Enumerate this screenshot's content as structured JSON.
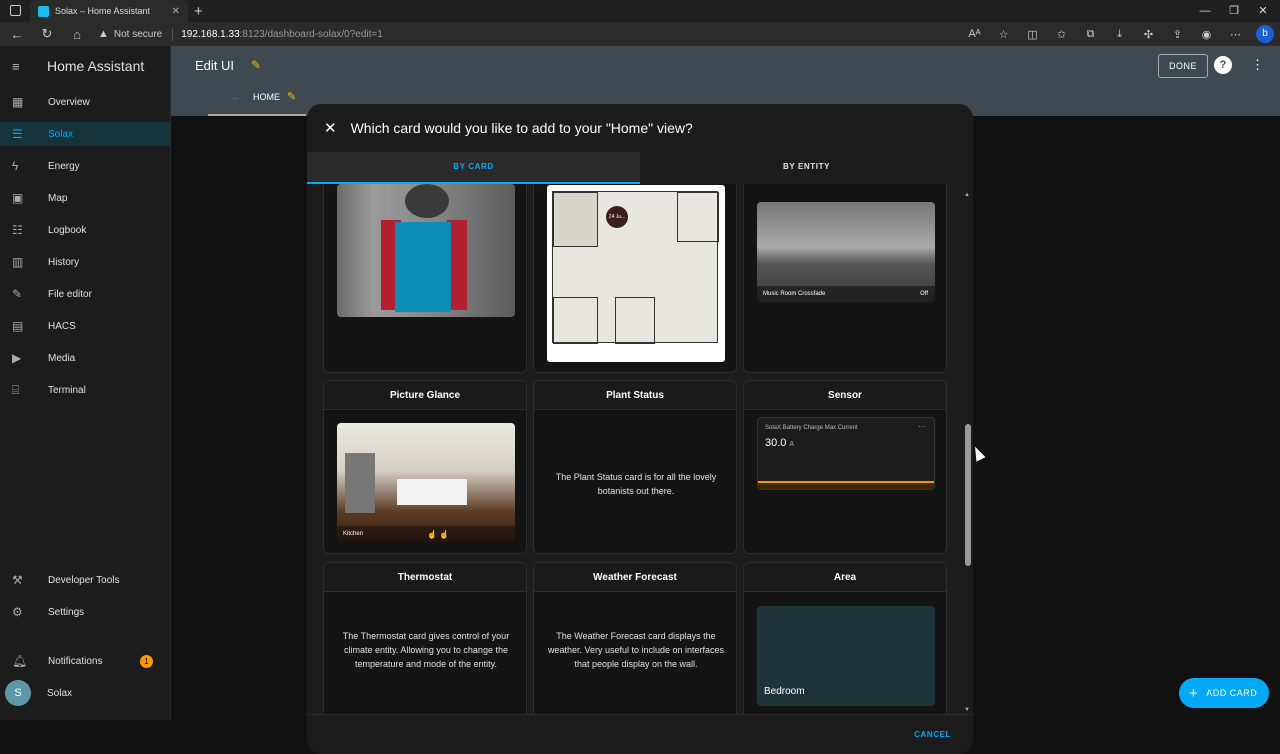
{
  "browser": {
    "tab_title": "Solax – Home Assistant",
    "security_label": "Not secure",
    "url_host": "192.168.1.33",
    "url_path": ":8123/dashboard-solax/0?edit=1"
  },
  "sidebar": {
    "title": "Home Assistant",
    "items": [
      {
        "label": "Overview",
        "icon": "dashboard-icon"
      },
      {
        "label": "Solax",
        "icon": "solax-dashboard-icon",
        "active": true
      },
      {
        "label": "Energy",
        "icon": "lightning-icon"
      },
      {
        "label": "Map",
        "icon": "map-icon"
      },
      {
        "label": "Logbook",
        "icon": "list-icon"
      },
      {
        "label": "History",
        "icon": "chart-icon"
      },
      {
        "label": "File editor",
        "icon": "wrench-icon"
      },
      {
        "label": "HACS",
        "icon": "hacs-icon"
      },
      {
        "label": "Media",
        "icon": "media-icon"
      },
      {
        "label": "Terminal",
        "icon": "terminal-icon"
      }
    ],
    "bottom": [
      {
        "label": "Developer Tools",
        "icon": "hammer-icon"
      },
      {
        "label": "Settings",
        "icon": "gear-icon"
      }
    ],
    "notifications_label": "Notifications",
    "notifications_count": "1",
    "user_label": "Solax",
    "user_initial": "S"
  },
  "topbar": {
    "title": "Edit UI",
    "view_tab": "HOME",
    "done_label": "DONE"
  },
  "dialog": {
    "title": "Which card would you like to add to your \"Home\" view?",
    "tabs": [
      "BY CARD",
      "BY ENTITY"
    ],
    "cards": {
      "picture_glance_title": "Picture Glance",
      "plant_status_title": "Plant Status",
      "plant_status_desc": "The Plant Status card is for all the lovely botanists out there.",
      "sensor_title": "Sensor",
      "sensor_preview_name": "SolaX Battery Charge Max Current",
      "sensor_preview_value": "30.0",
      "sensor_preview_unit": "A",
      "thermostat_title": "Thermostat",
      "thermostat_desc": "The Thermostat card gives control of your climate entity. Allowing you to change the temperature and mode of the entity.",
      "weather_title": "Weather Forecast",
      "weather_desc": "The Weather Forecast card displays the weather. Very useful to include on interfaces that people display on the wall.",
      "area_title": "Area",
      "area_preview_label": "Bedroom",
      "music_label": "Music Room Crossfade",
      "music_state": "Off",
      "kitchen_label": "Kitchen",
      "floorplan_badge": "24 Ju..."
    },
    "cancel_label": "CANCEL"
  },
  "fab": {
    "label": "ADD CARD"
  },
  "colors": {
    "accent": "#03a9f4",
    "header": "#3e4a4f",
    "warning": "#ff9800"
  }
}
